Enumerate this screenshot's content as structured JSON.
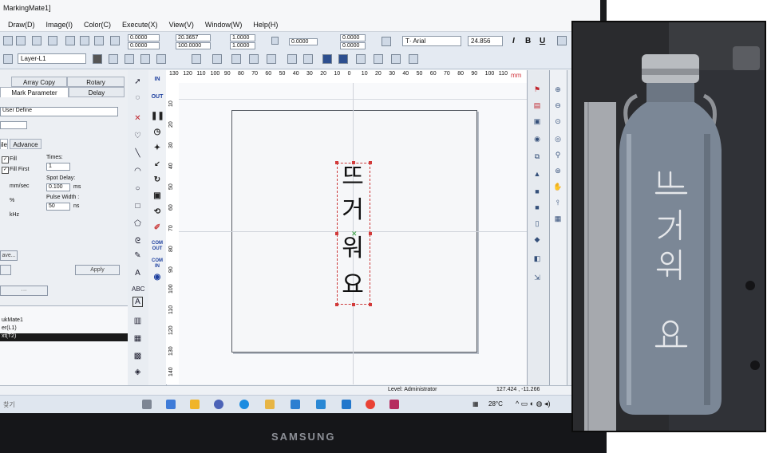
{
  "app": {
    "title": "MarkingMate1]"
  },
  "menu": [
    "Draw(D)",
    "Image(I)",
    "Color(C)",
    "Execute(X)",
    "View(V)",
    "Window(W)",
    "Help(H)"
  ],
  "toolbar": {
    "x": "0.0000",
    "y": "0.0000",
    "w": "20.3657",
    "h": "100.0000",
    "sx": "1.0000",
    "sy": "1.0000",
    "angle": "0.0000",
    "ox": "0.0000",
    "oy": "0.0000",
    "font": "T· Arial",
    "font_size": "24.856",
    "bold": "B",
    "italic": "I",
    "underline": "U",
    "layer": "Layer-L1"
  },
  "left_panel": {
    "tabs_top": [
      "Array Copy",
      "Rotary"
    ],
    "tabs_bottom": [
      "Mark Parameter",
      "Delay"
    ],
    "preset": "User Define",
    "subtabs": [
      "ile",
      "Advance"
    ],
    "fill": "Fill",
    "fill_first": "Fill First",
    "speed_unit": "mm/sec",
    "percent": "%",
    "khz": "kHz",
    "times_label": "Times:",
    "times_value": "1",
    "spot_delay_label": "Spot Delay:",
    "spot_delay_value": "0.100",
    "spot_delay_unit": "ms",
    "pulse_width_label": "Pulse Width :",
    "pulse_width_value": "50",
    "pulse_width_unit": "ns",
    "save_button": "ave...",
    "apply_button": "Apply",
    "dim_button": "···",
    "tree": [
      "ukMate1",
      "er(L1)",
      "xt(T2)"
    ]
  },
  "ruler": {
    "h_ticks": [
      "130",
      "120",
      "110",
      "100",
      "90",
      "80",
      "70",
      "60",
      "50",
      "40",
      "30",
      "20",
      "10",
      "0",
      "10",
      "20",
      "30",
      "40",
      "50",
      "60",
      "70",
      "80",
      "90",
      "100",
      "110"
    ],
    "unit": "mm",
    "v_ticks": [
      "10",
      "20",
      "30",
      "40",
      "50",
      "60",
      "70",
      "80",
      "90",
      "100",
      "110",
      "120",
      "130",
      "140"
    ]
  },
  "canvas": {
    "text_chars": [
      "뜨",
      "거",
      "워",
      "요"
    ]
  },
  "status": {
    "level": "Level: Administrator",
    "coords": "127.424 , -11.266"
  },
  "taskbar": {
    "search": "찾기",
    "weather": "28°C"
  },
  "monitor_brand": "SAMSUNG",
  "colors": {
    "accent_blue": "#1d3f9e",
    "selection_red": "#d23a3a",
    "mm_red": "#d0333b"
  }
}
